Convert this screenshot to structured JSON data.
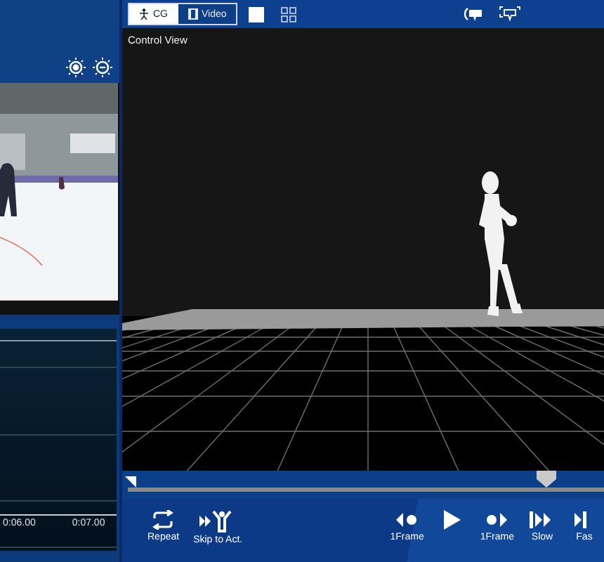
{
  "left_panel": {
    "zoom_buttons": [
      {
        "kind": "zoom-in"
      },
      {
        "kind": "zoom-out"
      }
    ],
    "timeline_labels": [
      "0:06.00",
      "0:07.00"
    ]
  },
  "toolbar": {
    "tabs": [
      {
        "label": "CG",
        "kind": "figure",
        "selected": true
      },
      {
        "label": "Video",
        "kind": "film",
        "selected": false
      }
    ],
    "layouts": [
      {
        "kind": "single",
        "selected": true
      },
      {
        "kind": "quad",
        "selected": false
      }
    ],
    "view_buttons": [
      {
        "kind": "camera"
      },
      {
        "kind": "screen"
      }
    ]
  },
  "view": {
    "title": "Control View"
  },
  "timeline": {
    "level": 0.88
  },
  "controls": [
    {
      "kind": "repeat",
      "label": "Repeat"
    },
    {
      "kind": "skip",
      "label": "Skip to Act."
    },
    {
      "kind": "spacer"
    },
    {
      "kind": "prev-frame",
      "label": "1Frame"
    },
    {
      "kind": "play"
    },
    {
      "kind": "next-frame",
      "label": "1Frame"
    },
    {
      "kind": "slow",
      "label": "Slow"
    },
    {
      "kind": "fast",
      "label": "Fas"
    }
  ]
}
